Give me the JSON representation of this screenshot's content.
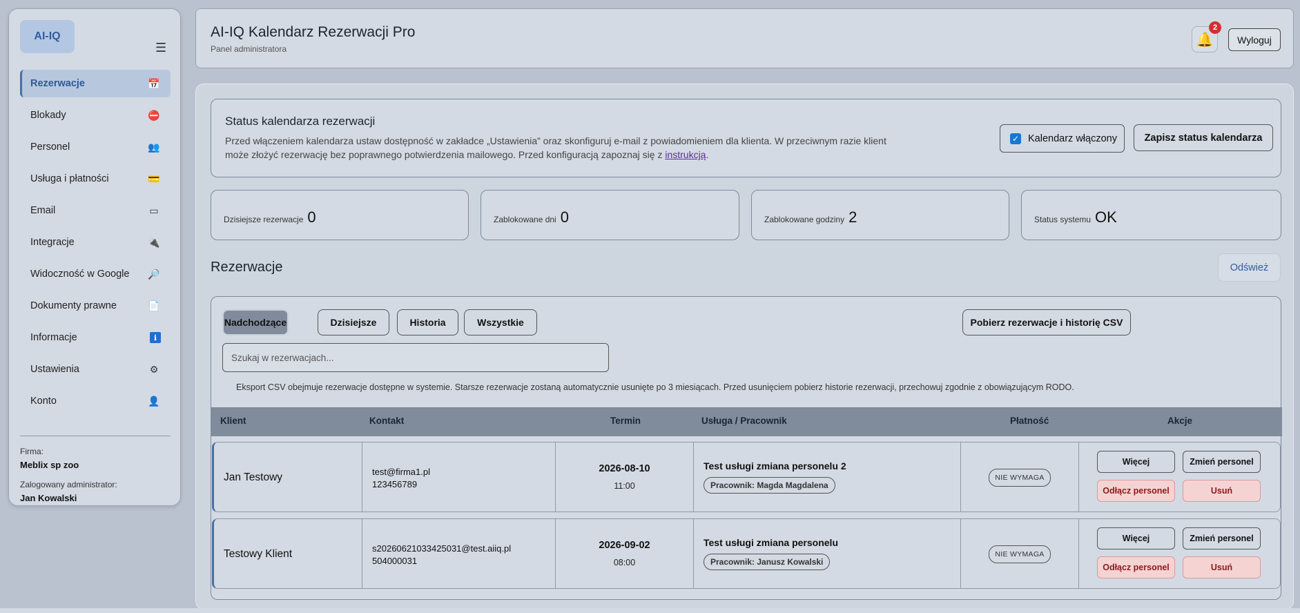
{
  "sidebar": {
    "logo": "AI-IQ",
    "menu_icon": "☰",
    "items": [
      {
        "label": "Rezerwacje",
        "icon": "📅",
        "icon_name": "calendar-icon"
      },
      {
        "label": "Blokady",
        "icon": "⛔",
        "icon_name": "no-entry-icon"
      },
      {
        "label": "Personel",
        "icon": "👥",
        "icon_name": "people-icon"
      },
      {
        "label": "Usługa i płatności",
        "icon": "💳",
        "icon_name": "credit-card-icon"
      },
      {
        "label": "Email",
        "icon": "▭",
        "icon_name": "email-icon"
      },
      {
        "label": "Integracje",
        "icon": "🔌",
        "icon_name": "plug-icon"
      },
      {
        "label": "Widoczność w Google",
        "icon": "🔎",
        "icon_name": "search-icon"
      },
      {
        "label": "Dokumenty prawne",
        "icon": "📄",
        "icon_name": "document-icon"
      },
      {
        "label": "Informacje",
        "icon": "ℹ",
        "icon_name": "info-icon"
      },
      {
        "label": "Ustawienia",
        "icon": "⚙",
        "icon_name": "gear-icon"
      },
      {
        "label": "Konto",
        "icon": "👤",
        "icon_name": "user-icon"
      }
    ],
    "company_label": "Firma:",
    "company_value": "Meblix sp zoo",
    "admin_label": "Zalogowany administrator:",
    "admin_value": "Jan Kowalski"
  },
  "header": {
    "title": "AI-IQ Kalendarz Rezerwacji Pro",
    "subtitle": "Panel administratora",
    "bell_icon": "🔔",
    "notifications": "2",
    "logout": "Wyloguj"
  },
  "status": {
    "title": "Status kalendarza rezerwacji",
    "text": "Przed włączeniem kalendarza ustaw dostępność w zakładce „Ustawienia” oraz skonfiguruj e-mail z powiadomieniem dla klienta. W przeciwnym razie klient może złożyć rezerwację bez poprawnego potwierdzenia mailowego. Przed konfiguracją zapoznaj się z ",
    "link": "instrukcją",
    "text_end": ".",
    "checkbox_mark": "✓",
    "checkbox_label": "Kalendarz włączony",
    "save_label": "Zapisz status kalendarza"
  },
  "stats": [
    {
      "label": "Dzisiejsze rezerwacje",
      "value": "0"
    },
    {
      "label": "Zablokowane dni",
      "value": "0"
    },
    {
      "label": "Zablokowane godziny",
      "value": "2"
    },
    {
      "label": "Status systemu",
      "value": "OK"
    }
  ],
  "reservations": {
    "title": "Rezerwacje",
    "refresh": "Odśwież",
    "tabs": [
      "Nadchodzące",
      "Dzisiejsze",
      "Historia",
      "Wszystkie"
    ],
    "csv": "Pobierz rezerwacje i historię CSV",
    "search_placeholder": "Szukaj w rezerwacjach...",
    "note": "Eksport CSV obejmuje rezerwacje dostępne w systemie. Starsze rezerwacje zostaną automatycznie usunięte po 3 miesiącach. Przed usunięciem pobierz historie rezerwacji, przechowuj zgodnie z obowiązującym RODO.",
    "columns": [
      "Klient",
      "Kontakt",
      "Termin",
      "Usługa / Pracownik",
      "Płatność",
      "Akcje"
    ],
    "rows": [
      {
        "client": "Jan Testowy",
        "email": "test@firma1.pl",
        "phone": "123456789",
        "date": "2026-08-10",
        "time": "11:00",
        "service": "Test usługi zmiana personelu 2",
        "worker": "Pracownik: Magda Magdalena",
        "payment": "NIE WYMAGA"
      },
      {
        "client": "Testowy Klient",
        "email": "s20260621033425031@test.aiiq.pl",
        "phone": "504000031",
        "date": "2026-09-02",
        "time": "08:00",
        "service": "Test usługi zmiana personelu",
        "worker": "Pracownik: Janusz Kowalski",
        "payment": "NIE WYMAGA"
      }
    ],
    "actions": {
      "more": "Więcej",
      "change": "Zmień personel",
      "detach": "Odłącz personel",
      "delete": "Usuń"
    }
  }
}
